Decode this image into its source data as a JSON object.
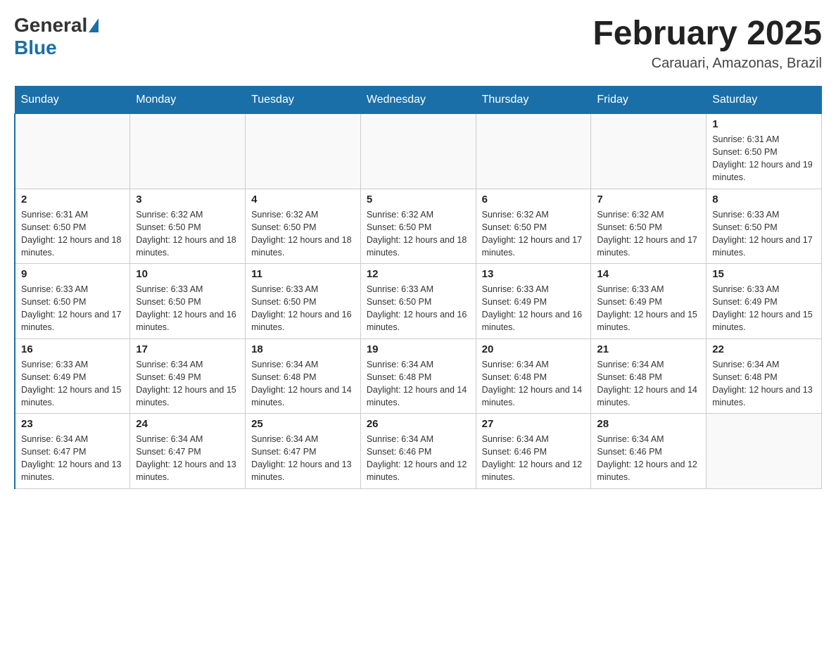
{
  "logo": {
    "text_general": "General",
    "text_blue": "Blue"
  },
  "header": {
    "month_title": "February 2025",
    "location": "Carauari, Amazonas, Brazil"
  },
  "days_of_week": [
    "Sunday",
    "Monday",
    "Tuesday",
    "Wednesday",
    "Thursday",
    "Friday",
    "Saturday"
  ],
  "weeks": [
    [
      {
        "day": "",
        "info": ""
      },
      {
        "day": "",
        "info": ""
      },
      {
        "day": "",
        "info": ""
      },
      {
        "day": "",
        "info": ""
      },
      {
        "day": "",
        "info": ""
      },
      {
        "day": "",
        "info": ""
      },
      {
        "day": "1",
        "info": "Sunrise: 6:31 AM\nSunset: 6:50 PM\nDaylight: 12 hours and 19 minutes."
      }
    ],
    [
      {
        "day": "2",
        "info": "Sunrise: 6:31 AM\nSunset: 6:50 PM\nDaylight: 12 hours and 18 minutes."
      },
      {
        "day": "3",
        "info": "Sunrise: 6:32 AM\nSunset: 6:50 PM\nDaylight: 12 hours and 18 minutes."
      },
      {
        "day": "4",
        "info": "Sunrise: 6:32 AM\nSunset: 6:50 PM\nDaylight: 12 hours and 18 minutes."
      },
      {
        "day": "5",
        "info": "Sunrise: 6:32 AM\nSunset: 6:50 PM\nDaylight: 12 hours and 18 minutes."
      },
      {
        "day": "6",
        "info": "Sunrise: 6:32 AM\nSunset: 6:50 PM\nDaylight: 12 hours and 17 minutes."
      },
      {
        "day": "7",
        "info": "Sunrise: 6:32 AM\nSunset: 6:50 PM\nDaylight: 12 hours and 17 minutes."
      },
      {
        "day": "8",
        "info": "Sunrise: 6:33 AM\nSunset: 6:50 PM\nDaylight: 12 hours and 17 minutes."
      }
    ],
    [
      {
        "day": "9",
        "info": "Sunrise: 6:33 AM\nSunset: 6:50 PM\nDaylight: 12 hours and 17 minutes."
      },
      {
        "day": "10",
        "info": "Sunrise: 6:33 AM\nSunset: 6:50 PM\nDaylight: 12 hours and 16 minutes."
      },
      {
        "day": "11",
        "info": "Sunrise: 6:33 AM\nSunset: 6:50 PM\nDaylight: 12 hours and 16 minutes."
      },
      {
        "day": "12",
        "info": "Sunrise: 6:33 AM\nSunset: 6:50 PM\nDaylight: 12 hours and 16 minutes."
      },
      {
        "day": "13",
        "info": "Sunrise: 6:33 AM\nSunset: 6:49 PM\nDaylight: 12 hours and 16 minutes."
      },
      {
        "day": "14",
        "info": "Sunrise: 6:33 AM\nSunset: 6:49 PM\nDaylight: 12 hours and 15 minutes."
      },
      {
        "day": "15",
        "info": "Sunrise: 6:33 AM\nSunset: 6:49 PM\nDaylight: 12 hours and 15 minutes."
      }
    ],
    [
      {
        "day": "16",
        "info": "Sunrise: 6:33 AM\nSunset: 6:49 PM\nDaylight: 12 hours and 15 minutes."
      },
      {
        "day": "17",
        "info": "Sunrise: 6:34 AM\nSunset: 6:49 PM\nDaylight: 12 hours and 15 minutes."
      },
      {
        "day": "18",
        "info": "Sunrise: 6:34 AM\nSunset: 6:48 PM\nDaylight: 12 hours and 14 minutes."
      },
      {
        "day": "19",
        "info": "Sunrise: 6:34 AM\nSunset: 6:48 PM\nDaylight: 12 hours and 14 minutes."
      },
      {
        "day": "20",
        "info": "Sunrise: 6:34 AM\nSunset: 6:48 PM\nDaylight: 12 hours and 14 minutes."
      },
      {
        "day": "21",
        "info": "Sunrise: 6:34 AM\nSunset: 6:48 PM\nDaylight: 12 hours and 14 minutes."
      },
      {
        "day": "22",
        "info": "Sunrise: 6:34 AM\nSunset: 6:48 PM\nDaylight: 12 hours and 13 minutes."
      }
    ],
    [
      {
        "day": "23",
        "info": "Sunrise: 6:34 AM\nSunset: 6:47 PM\nDaylight: 12 hours and 13 minutes."
      },
      {
        "day": "24",
        "info": "Sunrise: 6:34 AM\nSunset: 6:47 PM\nDaylight: 12 hours and 13 minutes."
      },
      {
        "day": "25",
        "info": "Sunrise: 6:34 AM\nSunset: 6:47 PM\nDaylight: 12 hours and 13 minutes."
      },
      {
        "day": "26",
        "info": "Sunrise: 6:34 AM\nSunset: 6:46 PM\nDaylight: 12 hours and 12 minutes."
      },
      {
        "day": "27",
        "info": "Sunrise: 6:34 AM\nSunset: 6:46 PM\nDaylight: 12 hours and 12 minutes."
      },
      {
        "day": "28",
        "info": "Sunrise: 6:34 AM\nSunset: 6:46 PM\nDaylight: 12 hours and 12 minutes."
      },
      {
        "day": "",
        "info": ""
      }
    ]
  ]
}
